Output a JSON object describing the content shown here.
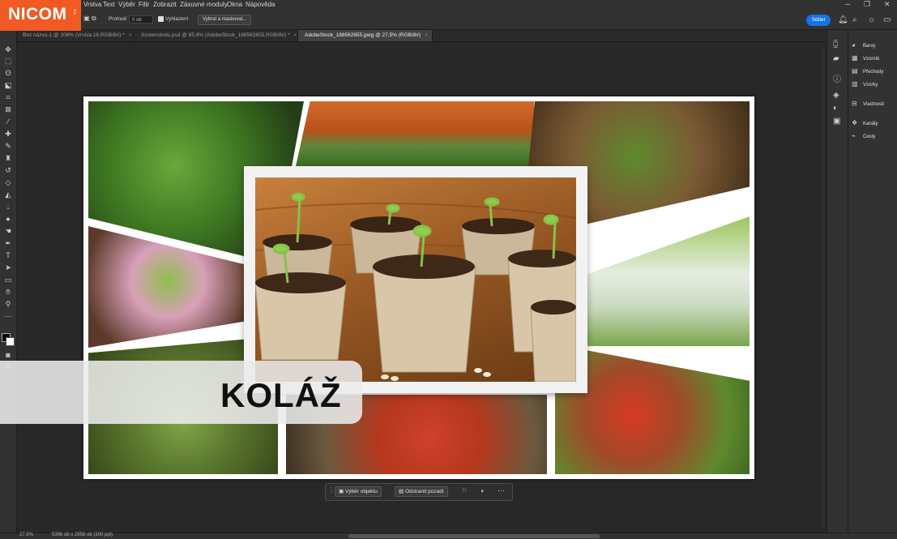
{
  "brand": {
    "logo_text": "NICOM",
    "logo_sub": "a.s.",
    "logo_color": "#f15a24"
  },
  "menu": [
    "Vrstva",
    "Text",
    "Výběr",
    "Filtr",
    "Zobrazit",
    "Zásuvné moduly",
    "Okna",
    "Nápověda"
  ],
  "options_bar": {
    "feather_label": "Prolnutí",
    "feather_value": "0 ob",
    "antialias_label": "Vyhlazení",
    "select_mask_label": "Vybrat a maskovat...",
    "share_label": "Sdílet"
  },
  "tabs": [
    {
      "label": "Bez názvu-1 @ 106% (Vrstva 18,RGB/8#) *",
      "active": false
    },
    {
      "label": "Screenshots.psd @ 65,9% (AdobeStock_188562855,RGB/8#) *",
      "active": false
    },
    {
      "label": "AdobeStock_188562855.jpeg @ 27,5% (RGB/8#)",
      "active": true
    }
  ],
  "panels": [
    {
      "label": "Barvy",
      "icon": "color-wheel-icon"
    },
    {
      "label": "Vzorník",
      "icon": "swatches-grid-icon"
    },
    {
      "label": "Přechody",
      "icon": "gradient-icon"
    },
    {
      "label": "Vzorky",
      "icon": "patterns-icon"
    },
    {
      "label": "Vlastnosti",
      "icon": "properties-icon"
    },
    {
      "label": "Kanály",
      "icon": "channels-icon"
    },
    {
      "label": "Cesty",
      "icon": "paths-icon"
    }
  ],
  "context_bar": {
    "select_subject": "Výběr objektu",
    "remove_bg": "Odstranit pozadí"
  },
  "status": {
    "zoom": "27,5%",
    "doc_info": "5396 ob x 2956 ob (300 ppi)"
  },
  "title_overlay": "KOLÁŽ"
}
